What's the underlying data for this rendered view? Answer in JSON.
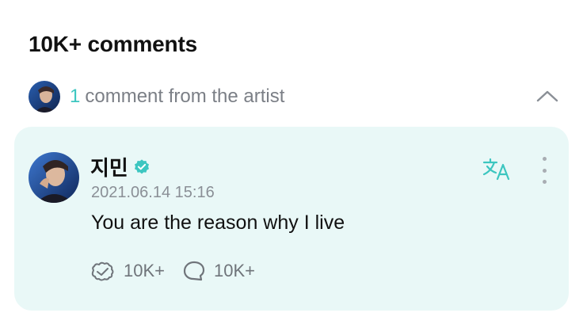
{
  "header": {
    "title": "10K+ comments"
  },
  "artist_comments": {
    "count": "1",
    "label": "comment from the artist",
    "collapse_icon": "chevron-up-icon"
  },
  "comment": {
    "author": "지민",
    "verified_icon": "verified-badge-icon",
    "timestamp": "2021.06.14 15:16",
    "text": "You are the reason why I live",
    "translate_icon": "translate-icon",
    "more_icon": "more-vertical-icon",
    "likes": "10K+",
    "replies": "10K+"
  },
  "colors": {
    "accent": "#3cc6c0",
    "card_background": "#e9f8f7",
    "muted_text": "#7b7f86"
  }
}
